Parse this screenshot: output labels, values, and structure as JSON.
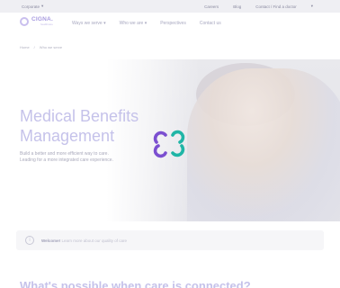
{
  "topbar": {
    "region_label": "Corporate",
    "links": [
      "Careers",
      "Blog",
      "Contact / Find a doctor"
    ]
  },
  "logo": {
    "brand": "CIGNA.",
    "sub": "healthcare"
  },
  "nav": {
    "items": [
      "Ways we serve",
      "Who we are",
      "Perspectives",
      "Contact us"
    ]
  },
  "breadcrumb": [
    "Home",
    "Who we serve"
  ],
  "hero": {
    "title": "Medical Benefits Management",
    "description": "Build a better and more efficient way to care. Leading for a more integrated care experience."
  },
  "notice": {
    "bold": "Welcome!",
    "text": "Learn more about our quality of care"
  },
  "bottom_heading": "What's possible when care is connected?",
  "colors": {
    "accent_purple": "#7b4fd0",
    "accent_teal": "#1fb5a6",
    "title_lavender": "#c5c2ea"
  }
}
